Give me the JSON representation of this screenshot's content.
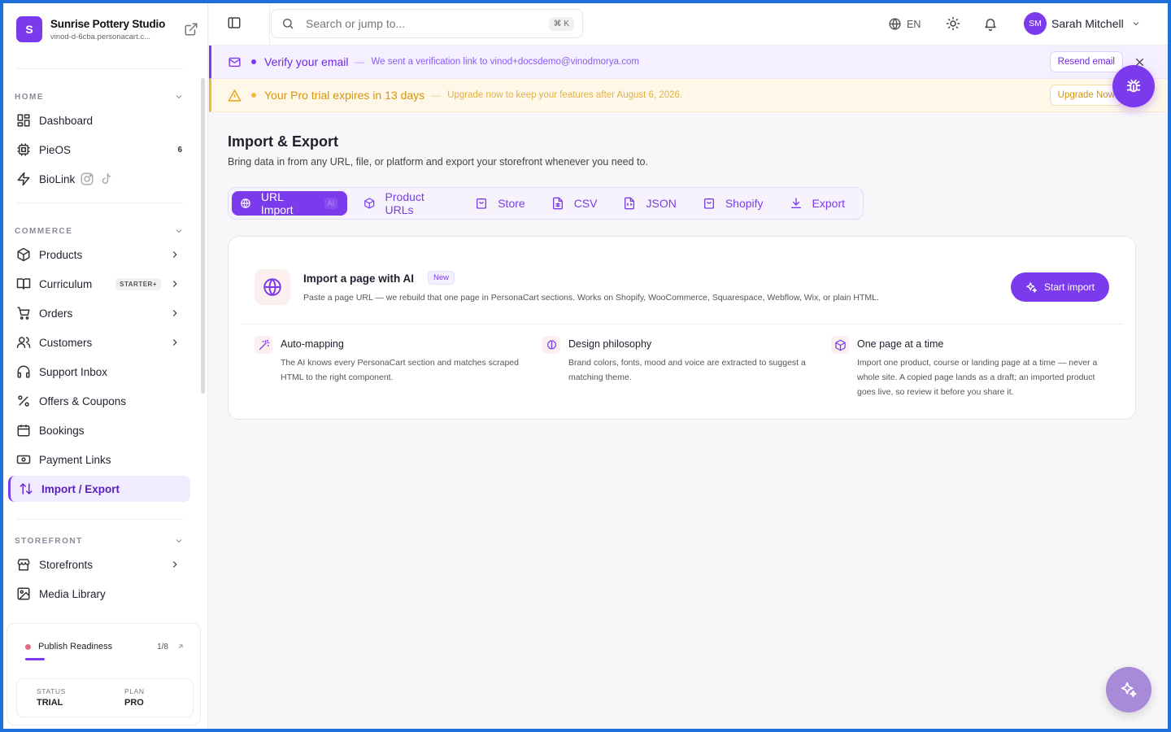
{
  "brand": {
    "initial": "S",
    "name": "Sunrise Pottery Studio",
    "url": "vinod-d-6cba.personacart.c..."
  },
  "sidebar": {
    "sections": {
      "home": "HOME",
      "commerce": "COMMERCE",
      "storefront": "STOREFRONT"
    },
    "items": {
      "dashboard": "Dashboard",
      "pieos": "PieOS",
      "pieos_count": "6",
      "biolink": "BioLink",
      "products": "Products",
      "curriculum": "Curriculum",
      "curriculum_badge": "STARTER+",
      "orders": "Orders",
      "customers": "Customers",
      "support": "Support Inbox",
      "offers": "Offers & Coupons",
      "bookings": "Bookings",
      "payment_links": "Payment Links",
      "import_export": "Import / Export",
      "storefronts": "Storefronts",
      "media": "Media Library"
    },
    "readiness": {
      "label": "Publish Readiness",
      "count": "1/8",
      "progress": 0.125,
      "status_key": "STATUS",
      "status_value": "TRIAL",
      "plan_key": "PLAN",
      "plan_value": "PRO"
    }
  },
  "topbar": {
    "search_placeholder": "Search or jump to...",
    "shortcut": "⌘ K",
    "language": "EN",
    "user_initials": "SM",
    "user_name": "Sarah Mitchell"
  },
  "banners": {
    "verify": {
      "title": "Verify your email",
      "sep": "—",
      "desc": "We sent a verification link to vinod+docsdemo@vinodmorya.com",
      "button": "Resend email"
    },
    "trial": {
      "title": "Your Pro trial expires in 13 days",
      "sep": "—",
      "desc": "Upgrade now to keep your features after August 6, 2026.",
      "button": "Upgrade Now"
    }
  },
  "main": {
    "title": "Import & Export",
    "subtitle": "Bring data in from any URL, file, or platform and export your storefront whenever you need to.",
    "tabs": [
      {
        "label": "URL Import",
        "badge": "AI"
      },
      {
        "label": "Product URLs"
      },
      {
        "label": "Store"
      },
      {
        "label": "CSV"
      },
      {
        "label": "JSON"
      },
      {
        "label": "Shopify"
      },
      {
        "label": "Export"
      }
    ],
    "card": {
      "title": "Import a page with AI",
      "badge": "New",
      "desc": "Paste a page URL — we rebuild that one page in PersonaCart sections. Works on Shopify, WooCommerce, Squarespace, Webflow, Wix, or plain HTML.",
      "button": "Start import",
      "features": [
        {
          "title": "Auto-mapping",
          "desc": "The AI knows every PersonaCart section and matches scraped HTML to the right component."
        },
        {
          "title": "Design philosophy",
          "desc": "Brand colors, fonts, mood and voice are extracted to suggest a matching theme."
        },
        {
          "title": "One page at a time",
          "desc": "Import one product, course or landing page at a time — never a whole site. A copied page lands as a draft; an imported product goes live, so review it before you share it."
        }
      ]
    }
  },
  "colors": {
    "accent": "#7c3aed",
    "warning": "#f4b740",
    "frame": "#1e6fd9"
  }
}
